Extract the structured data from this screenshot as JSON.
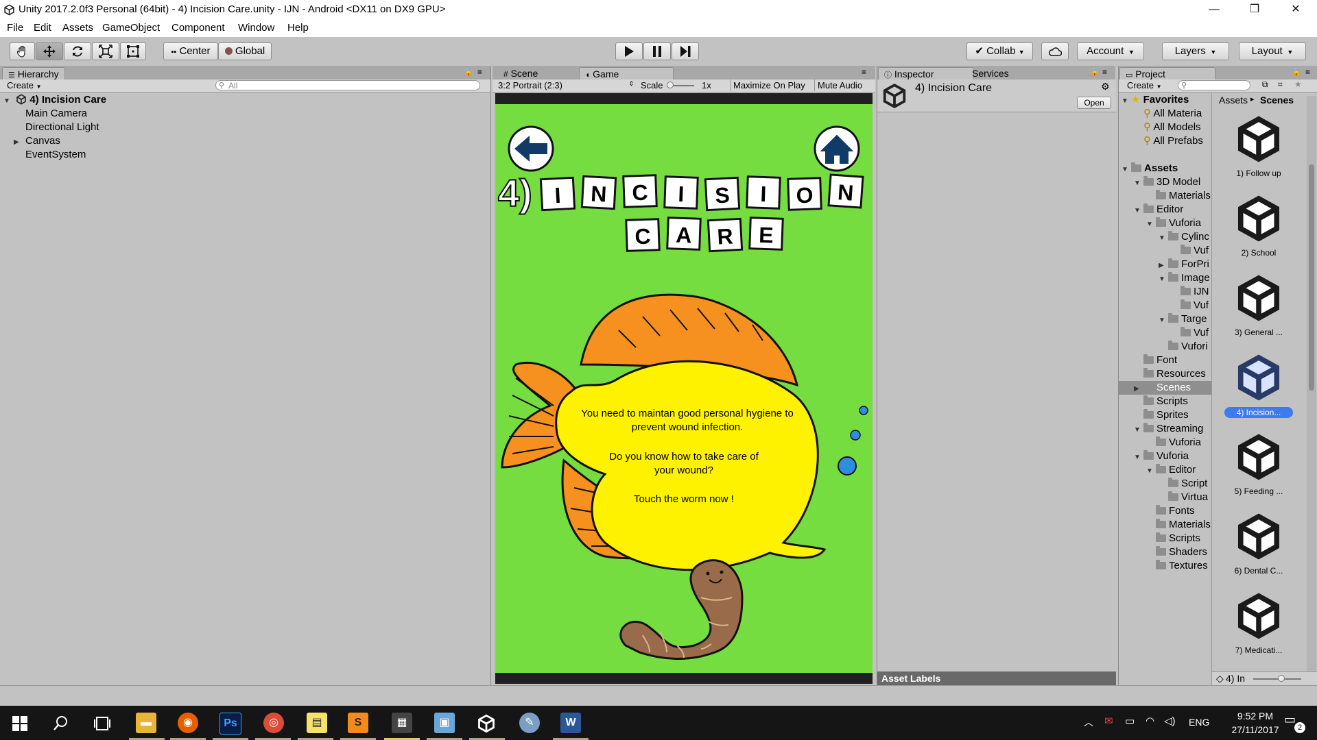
{
  "window": {
    "title": "Unity 2017.2.0f3 Personal (64bit) - 4) Incision Care.unity - IJN - Android <DX11 on DX9 GPU>",
    "min": "—",
    "max": "❐",
    "close": "✕"
  },
  "menu": [
    "File",
    "Edit",
    "Assets",
    "GameObject",
    "Component",
    "Window",
    "Help"
  ],
  "toolbar": {
    "pivot": "Center",
    "space": "Global",
    "collab": "Collab",
    "account": "Account",
    "layers": "Layers",
    "layout": "Layout"
  },
  "hierarchy": {
    "tab": "Hierarchy",
    "create": "Create",
    "search_placeholder": "All",
    "scene": "4) Incision Care",
    "items": [
      "Main Camera",
      "Directional Light",
      "Canvas",
      "EventSystem"
    ]
  },
  "game": {
    "tab_scene": "Scene",
    "tab_game": "Game",
    "aspect": "3:2 Portrait (2:3)",
    "scale_label": "Scale",
    "scale_value": "1x",
    "maximize": "Maximize On Play",
    "mute": "Mute Audio",
    "title_line1": [
      "I",
      "N",
      "C",
      "I",
      "S",
      "I",
      "O",
      "N"
    ],
    "title_prefix": "4)",
    "title_line2": [
      "C",
      "A",
      "R",
      "E"
    ],
    "message_1": "You need to maintan good personal hygiene to prevent wound infection.",
    "message_2": "Do you know how to take care of your wound?",
    "message_3": "Touch the worm now !"
  },
  "inspector": {
    "tab": "Inspector",
    "tab_services": "Services",
    "object": "4) Incision Care",
    "open": "Open",
    "asset_labels": "Asset Labels"
  },
  "project": {
    "tab": "Project",
    "create": "Create",
    "favorites_title": "Favorites",
    "favorites": [
      "All Materia",
      "All Models",
      "All Prefabs"
    ],
    "assets_title": "Assets",
    "tree": [
      {
        "label": "3D Model",
        "depth": 1,
        "arrow": "down"
      },
      {
        "label": "Materials",
        "depth": 2,
        "arrow": ""
      },
      {
        "label": "Editor",
        "depth": 1,
        "arrow": "down"
      },
      {
        "label": "Vuforia",
        "depth": 2,
        "arrow": "down"
      },
      {
        "label": "Cylinc",
        "depth": 3,
        "arrow": "down"
      },
      {
        "label": "Vuf",
        "depth": 4,
        "arrow": ""
      },
      {
        "label": "ForPri",
        "depth": 3,
        "arrow": "right"
      },
      {
        "label": "Image",
        "depth": 3,
        "arrow": "down"
      },
      {
        "label": "IJN",
        "depth": 4,
        "arrow": ""
      },
      {
        "label": "Vuf",
        "depth": 4,
        "arrow": ""
      },
      {
        "label": "Targe",
        "depth": 3,
        "arrow": "down"
      },
      {
        "label": "Vuf",
        "depth": 4,
        "arrow": ""
      },
      {
        "label": "Vufori",
        "depth": 3,
        "arrow": ""
      },
      {
        "label": "Font",
        "depth": 1,
        "arrow": ""
      },
      {
        "label": "Resources",
        "depth": 1,
        "arrow": ""
      },
      {
        "label": "Scenes",
        "depth": 1,
        "arrow": "right",
        "selected": true
      },
      {
        "label": "Scripts",
        "depth": 1,
        "arrow": ""
      },
      {
        "label": "Sprites",
        "depth": 1,
        "arrow": ""
      },
      {
        "label": "Streaming",
        "depth": 1,
        "arrow": "down"
      },
      {
        "label": "Vuforia",
        "depth": 2,
        "arrow": ""
      },
      {
        "label": "Vuforia",
        "depth": 1,
        "arrow": "down"
      },
      {
        "label": "Editor",
        "depth": 2,
        "arrow": "down"
      },
      {
        "label": "Script",
        "depth": 3,
        "arrow": ""
      },
      {
        "label": "Virtua",
        "depth": 3,
        "arrow": ""
      },
      {
        "label": "Fonts",
        "depth": 2,
        "arrow": ""
      },
      {
        "label": "Materials",
        "depth": 2,
        "arrow": ""
      },
      {
        "label": "Scripts",
        "depth": 2,
        "arrow": ""
      },
      {
        "label": "Shaders",
        "depth": 2,
        "arrow": ""
      },
      {
        "label": "Textures",
        "depth": 2,
        "arrow": ""
      }
    ],
    "breadcrumb_root": "Assets",
    "breadcrumb_sep": "▸",
    "breadcrumb_current": "Scenes",
    "scenes": [
      "1) Follow up",
      "2) School",
      "3) General ...",
      "4) Incision...",
      "5) Feeding ...",
      "6) Dental C...",
      "7) Medicati..."
    ],
    "selected_scene_index": 3,
    "footer": "4) In"
  },
  "taskbar": {
    "time": "9:52 PM",
    "date": "27/11/2017",
    "lang": "ENG",
    "notif": "2",
    "apps": [
      "file-explorer",
      "firefox",
      "photoshop",
      "chrome",
      "sticky-notes",
      "sublime-text",
      "clapperboard",
      "paint",
      "unity",
      "palette",
      "word"
    ]
  }
}
